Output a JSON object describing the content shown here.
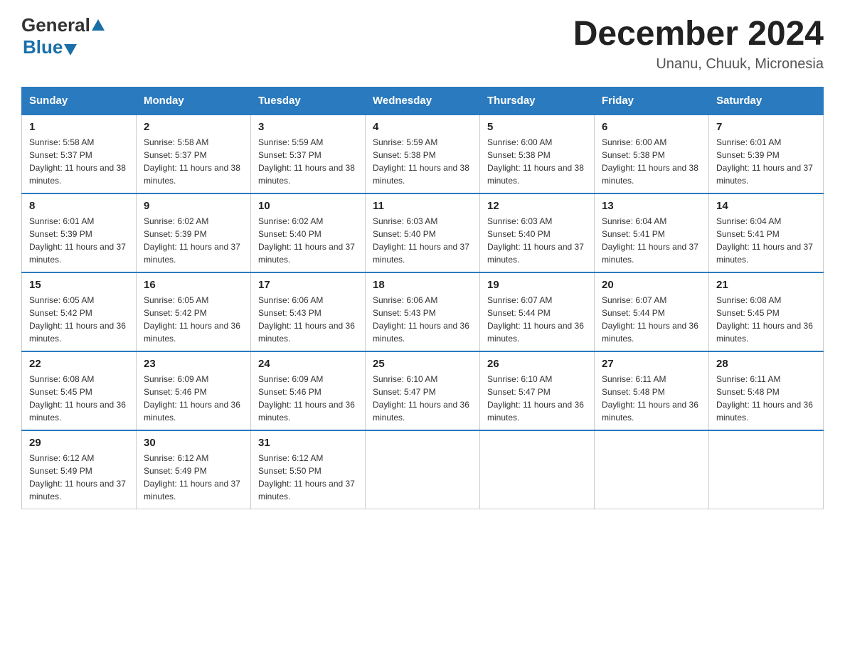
{
  "logo": {
    "general": "General",
    "blue": "Blue"
  },
  "header": {
    "title": "December 2024",
    "subtitle": "Unanu, Chuuk, Micronesia"
  },
  "weekdays": [
    "Sunday",
    "Monday",
    "Tuesday",
    "Wednesday",
    "Thursday",
    "Friday",
    "Saturday"
  ],
  "weeks": [
    [
      {
        "day": "1",
        "sunrise": "5:58 AM",
        "sunset": "5:37 PM",
        "daylight": "11 hours and 38 minutes."
      },
      {
        "day": "2",
        "sunrise": "5:58 AM",
        "sunset": "5:37 PM",
        "daylight": "11 hours and 38 minutes."
      },
      {
        "day": "3",
        "sunrise": "5:59 AM",
        "sunset": "5:37 PM",
        "daylight": "11 hours and 38 minutes."
      },
      {
        "day": "4",
        "sunrise": "5:59 AM",
        "sunset": "5:38 PM",
        "daylight": "11 hours and 38 minutes."
      },
      {
        "day": "5",
        "sunrise": "6:00 AM",
        "sunset": "5:38 PM",
        "daylight": "11 hours and 38 minutes."
      },
      {
        "day": "6",
        "sunrise": "6:00 AM",
        "sunset": "5:38 PM",
        "daylight": "11 hours and 38 minutes."
      },
      {
        "day": "7",
        "sunrise": "6:01 AM",
        "sunset": "5:39 PM",
        "daylight": "11 hours and 37 minutes."
      }
    ],
    [
      {
        "day": "8",
        "sunrise": "6:01 AM",
        "sunset": "5:39 PM",
        "daylight": "11 hours and 37 minutes."
      },
      {
        "day": "9",
        "sunrise": "6:02 AM",
        "sunset": "5:39 PM",
        "daylight": "11 hours and 37 minutes."
      },
      {
        "day": "10",
        "sunrise": "6:02 AM",
        "sunset": "5:40 PM",
        "daylight": "11 hours and 37 minutes."
      },
      {
        "day": "11",
        "sunrise": "6:03 AM",
        "sunset": "5:40 PM",
        "daylight": "11 hours and 37 minutes."
      },
      {
        "day": "12",
        "sunrise": "6:03 AM",
        "sunset": "5:40 PM",
        "daylight": "11 hours and 37 minutes."
      },
      {
        "day": "13",
        "sunrise": "6:04 AM",
        "sunset": "5:41 PM",
        "daylight": "11 hours and 37 minutes."
      },
      {
        "day": "14",
        "sunrise": "6:04 AM",
        "sunset": "5:41 PM",
        "daylight": "11 hours and 37 minutes."
      }
    ],
    [
      {
        "day": "15",
        "sunrise": "6:05 AM",
        "sunset": "5:42 PM",
        "daylight": "11 hours and 36 minutes."
      },
      {
        "day": "16",
        "sunrise": "6:05 AM",
        "sunset": "5:42 PM",
        "daylight": "11 hours and 36 minutes."
      },
      {
        "day": "17",
        "sunrise": "6:06 AM",
        "sunset": "5:43 PM",
        "daylight": "11 hours and 36 minutes."
      },
      {
        "day": "18",
        "sunrise": "6:06 AM",
        "sunset": "5:43 PM",
        "daylight": "11 hours and 36 minutes."
      },
      {
        "day": "19",
        "sunrise": "6:07 AM",
        "sunset": "5:44 PM",
        "daylight": "11 hours and 36 minutes."
      },
      {
        "day": "20",
        "sunrise": "6:07 AM",
        "sunset": "5:44 PM",
        "daylight": "11 hours and 36 minutes."
      },
      {
        "day": "21",
        "sunrise": "6:08 AM",
        "sunset": "5:45 PM",
        "daylight": "11 hours and 36 minutes."
      }
    ],
    [
      {
        "day": "22",
        "sunrise": "6:08 AM",
        "sunset": "5:45 PM",
        "daylight": "11 hours and 36 minutes."
      },
      {
        "day": "23",
        "sunrise": "6:09 AM",
        "sunset": "5:46 PM",
        "daylight": "11 hours and 36 minutes."
      },
      {
        "day": "24",
        "sunrise": "6:09 AM",
        "sunset": "5:46 PM",
        "daylight": "11 hours and 36 minutes."
      },
      {
        "day": "25",
        "sunrise": "6:10 AM",
        "sunset": "5:47 PM",
        "daylight": "11 hours and 36 minutes."
      },
      {
        "day": "26",
        "sunrise": "6:10 AM",
        "sunset": "5:47 PM",
        "daylight": "11 hours and 36 minutes."
      },
      {
        "day": "27",
        "sunrise": "6:11 AM",
        "sunset": "5:48 PM",
        "daylight": "11 hours and 36 minutes."
      },
      {
        "day": "28",
        "sunrise": "6:11 AM",
        "sunset": "5:48 PM",
        "daylight": "11 hours and 36 minutes."
      }
    ],
    [
      {
        "day": "29",
        "sunrise": "6:12 AM",
        "sunset": "5:49 PM",
        "daylight": "11 hours and 37 minutes."
      },
      {
        "day": "30",
        "sunrise": "6:12 AM",
        "sunset": "5:49 PM",
        "daylight": "11 hours and 37 minutes."
      },
      {
        "day": "31",
        "sunrise": "6:12 AM",
        "sunset": "5:50 PM",
        "daylight": "11 hours and 37 minutes."
      },
      null,
      null,
      null,
      null
    ]
  ]
}
